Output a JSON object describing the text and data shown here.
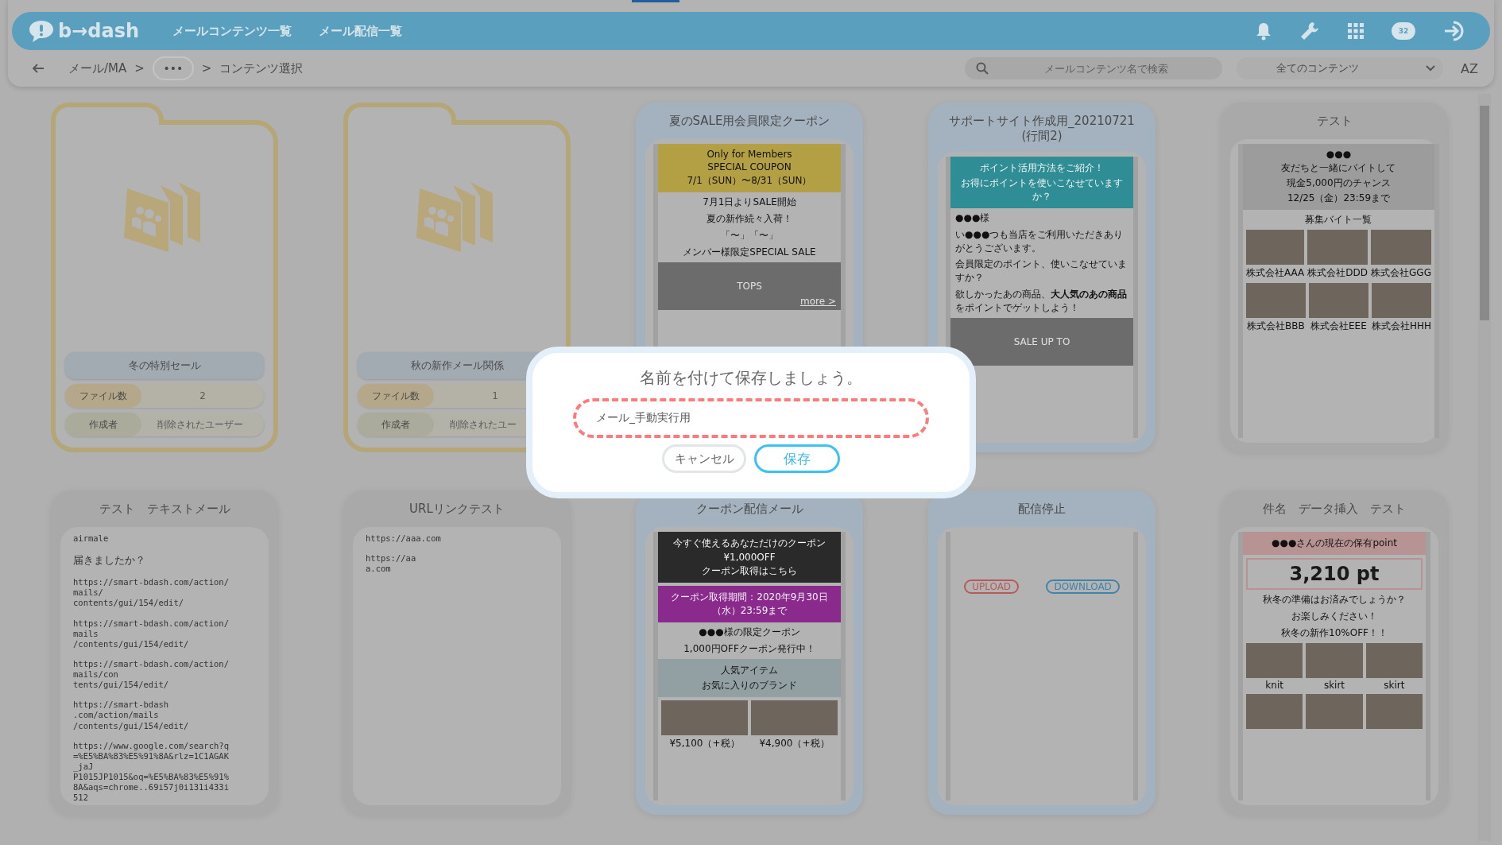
{
  "loading": {
    "level": 0.2
  },
  "topbar": {
    "logo": "b→dash",
    "nav": [
      {
        "label": "メールコンテンツ一覧"
      },
      {
        "label": "メール配信一覧"
      }
    ],
    "badge": "32"
  },
  "breadcrumb": {
    "items": [
      {
        "label": "メール/MA",
        "kind": "link"
      },
      {
        "label": ">",
        "kind": "sep"
      },
      {
        "label": "•••",
        "kind": "more"
      },
      {
        "label": ">",
        "kind": "sep"
      },
      {
        "label": "コンテンツ選択",
        "kind": "current"
      }
    ]
  },
  "search": {
    "placeholder": "メールコンテンツ名で検索"
  },
  "filter": {
    "value": "全てのコンテンツ"
  },
  "sort": {
    "label": "AZ"
  },
  "cards": [
    {
      "kind": "folder",
      "name": "冬の特別セール",
      "rows": [
        {
          "label": "ファイル数",
          "value": "2",
          "kind": "count"
        },
        {
          "label": "作成者",
          "value": "削除されたユーザー",
          "kind": "owner"
        }
      ]
    },
    {
      "kind": "folder",
      "name": "秋の新作メール関係",
      "rows": [
        {
          "label": "ファイル数",
          "value": "1",
          "kind": "count"
        },
        {
          "label": "作成者",
          "value": "削除されたユー",
          "kind": "owner"
        }
      ]
    },
    {
      "kind": "html",
      "color": "#a4b2bf",
      "title": "夏のSALE用会員限定クーポン",
      "preview": [
        {
          "kind": "banner",
          "color": "#b3a045",
          "lines": [
            "Only for Members",
            "SPECIAL COUPON",
            "7/1（SUN）〜8/31（SUN）"
          ]
        },
        {
          "kind": "line",
          "text": "7月1日よりSALE開始"
        },
        {
          "kind": "line",
          "text": "夏の新作続々入荷！"
        },
        {
          "kind": "line",
          "text": "「〜」「〜」"
        },
        {
          "kind": "line",
          "text": "メンバー様限定SPECIAL SALE"
        },
        {
          "kind": "photo",
          "caption": "TOPS",
          "link": "more >"
        }
      ]
    },
    {
      "kind": "html",
      "color": "#a4b2bf",
      "title": "サポートサイト作成用_20210721 (行間2)",
      "preview": [
        {
          "kind": "dark-banner",
          "color": "#2f8d95",
          "lines": [
            "ポイント活用方法をご紹介！",
            "お得にポイントを使いこなせていますか？"
          ]
        },
        {
          "kind": "para",
          "text": "●●●様"
        },
        {
          "kind": "para",
          "text": "い●●●つも当店をご利用いただきありがとうございます。"
        },
        {
          "kind": "para",
          "text": "会員限定のポイント、使いこなせていますか？"
        },
        {
          "kind": "para",
          "text": "欲しかったあの商品、**大人気のあの商品**をポイントでゲットしよう！"
        },
        {
          "kind": "photo",
          "caption": "SALE UP TO"
        }
      ]
    },
    {
      "kind": "html",
      "color": "#a9a9a9",
      "title": "テスト",
      "preview": [
        {
          "kind": "banner",
          "color": "#9c9c9c",
          "lines": [
            "●●●",
            "友だちと一緒にバイトして",
            "現金5,000円のチャンス",
            "12/25（金）23:59まで"
          ]
        },
        {
          "kind": "line",
          "text": "募集バイト一覧"
        },
        {
          "kind": "photos",
          "items": [
            {
              "kind": "photo",
              "caption": "株式会社AAA"
            },
            {
              "kind": "photo",
              "caption": "株式会社DDD"
            },
            {
              "kind": "photo",
              "caption": "株式会社GGG"
            }
          ]
        },
        {
          "kind": "photos",
          "items": [
            {
              "kind": "photo",
              "caption": "株式会社BBB"
            },
            {
              "kind": "photo",
              "caption": "株式会社EEE"
            },
            {
              "kind": "photo",
              "caption": "株式会社HHH"
            }
          ]
        }
      ]
    },
    {
      "kind": "text",
      "color": "#a9a9a9",
      "title": "テスト　テキストメール",
      "blocks": [
        {
          "kind": "mono",
          "text": "airmale"
        },
        {
          "kind": "plain",
          "text": "届きましたか？"
        },
        {
          "kind": "mono",
          "text": "https://smart-bdash.com/action/\nmails/\ncontents/gui/154/edit/"
        },
        {
          "kind": "mono",
          "text": "https://smart-bdash.com/action/\nmails\n/contents/gui/154/edit/"
        },
        {
          "kind": "mono",
          "text": "https://smart-bdash.com/action/\nmails/con\ntents/gui/154/edit/"
        },
        {
          "kind": "mono",
          "text": "https://smart-bdash\n.com/action/mails\n/contents/gui/154/edit/"
        },
        {
          "kind": "mono",
          "text": "https://www.google.com/search?q\n=%E5%BA%83%E5%91%8A&rlz=1C1AGAK\n_jaJ\nP1015JP1015&oq=%E5%BA%83%E5%91%\n8A&aqs=chrome..69i57j0i131i433i\n512"
        }
      ]
    },
    {
      "kind": "text",
      "color": "#a9a9a9",
      "title": "URLリンクテスト",
      "blocks": [
        {
          "kind": "mono",
          "text": "https://aaa.com"
        },
        {
          "kind": "mono",
          "text": "https://aa\na.com"
        }
      ]
    },
    {
      "kind": "html",
      "color": "#a4b2bf",
      "title": "クーポン配信メール",
      "preview": [
        {
          "kind": "dark-banner",
          "color": "#2a2a2a",
          "lines": [
            "今すぐ使えるあなただけのクーポン",
            "¥1,000OFF",
            "クーポン取得はこちら"
          ]
        },
        {
          "kind": "dark-banner",
          "color": "#8a2a8c",
          "lines": [
            "クーポン取得期間：2020年9月30日（水）23:59まで"
          ]
        },
        {
          "kind": "line",
          "text": "●●●様の限定クーポン"
        },
        {
          "kind": "line",
          "text": "1,000円OFFクーポン発行中！"
        },
        {
          "kind": "banner",
          "color": "#93a0a3",
          "lines": [
            "人気アイテム",
            "お気に入りのブランド"
          ]
        },
        {
          "kind": "photos",
          "items": [
            {
              "kind": "photo",
              "caption": "¥5,100（+税）"
            },
            {
              "kind": "photo",
              "caption": "¥4,900（+税）"
            }
          ]
        }
      ]
    },
    {
      "kind": "html",
      "color": "#a4b2bf",
      "title": "配信停止",
      "preview": [
        {
          "kind": "pills",
          "items": [
            {
              "label": "UPLOAD",
              "color": "#b85a5a"
            },
            {
              "label": "DOWNLOAD",
              "color": "#3f84aa"
            }
          ]
        }
      ]
    },
    {
      "kind": "html",
      "color": "#a9a9a9",
      "title": "件名　データ挿入　テスト",
      "preview": [
        {
          "kind": "banner",
          "color": "#b89393",
          "lines": [
            "●●●さんの現在の保有point"
          ]
        },
        {
          "kind": "big",
          "text": "3,210 pt"
        },
        {
          "kind": "line",
          "text": "秋冬の準備はお済みでしょうか？"
        },
        {
          "kind": "line",
          "text": "お楽しみください！"
        },
        {
          "kind": "line",
          "text": "秋冬の新作10%OFF！！"
        },
        {
          "kind": "photos",
          "items": [
            {
              "kind": "photo",
              "caption": "knit"
            },
            {
              "kind": "photo",
              "caption": "skirt"
            },
            {
              "kind": "photo",
              "caption": "skirt"
            }
          ]
        },
        {
          "kind": "photos",
          "items": [
            {
              "kind": "photo"
            },
            {
              "kind": "photo"
            },
            {
              "kind": "photo"
            }
          ]
        }
      ]
    }
  ],
  "dialog": {
    "title": "名前を付けて保存しましょう。",
    "value": "メール_手動実行用",
    "buttons": [
      {
        "label": "キャンセル",
        "kind": "cancel"
      },
      {
        "label": "保存",
        "kind": "primary"
      }
    ]
  }
}
